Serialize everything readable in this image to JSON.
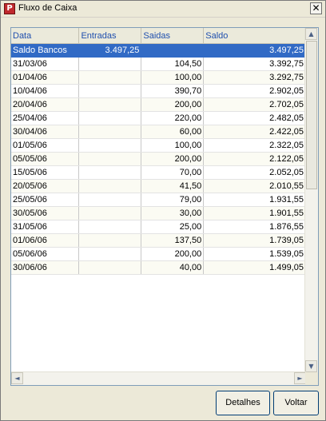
{
  "window": {
    "title": "Fluxo de Caixa",
    "icon_name": "app-logo-icon",
    "close_label": "✕"
  },
  "table": {
    "columns": [
      "Data",
      "Entradas",
      "Saidas",
      "Saldo"
    ],
    "rows": [
      {
        "data": "Saldo Bancos",
        "entradas": "3.497,25",
        "saidas": "",
        "saldo": "3.497,25"
      },
      {
        "data": "31/03/06",
        "entradas": "",
        "saidas": "104,50",
        "saldo": "3.392,75"
      },
      {
        "data": "01/04/06",
        "entradas": "",
        "saidas": "100,00",
        "saldo": "3.292,75"
      },
      {
        "data": "10/04/06",
        "entradas": "",
        "saidas": "390,70",
        "saldo": "2.902,05"
      },
      {
        "data": "20/04/06",
        "entradas": "",
        "saidas": "200,00",
        "saldo": "2.702,05"
      },
      {
        "data": "25/04/06",
        "entradas": "",
        "saidas": "220,00",
        "saldo": "2.482,05"
      },
      {
        "data": "30/04/06",
        "entradas": "",
        "saidas": "60,00",
        "saldo": "2.422,05"
      },
      {
        "data": "01/05/06",
        "entradas": "",
        "saidas": "100,00",
        "saldo": "2.322,05"
      },
      {
        "data": "05/05/06",
        "entradas": "",
        "saidas": "200,00",
        "saldo": "2.122,05"
      },
      {
        "data": "15/05/06",
        "entradas": "",
        "saidas": "70,00",
        "saldo": "2.052,05"
      },
      {
        "data": "20/05/06",
        "entradas": "",
        "saidas": "41,50",
        "saldo": "2.010,55"
      },
      {
        "data": "25/05/06",
        "entradas": "",
        "saidas": "79,00",
        "saldo": "1.931,55"
      },
      {
        "data": "30/05/06",
        "entradas": "",
        "saidas": "30,00",
        "saldo": "1.901,55"
      },
      {
        "data": "31/05/06",
        "entradas": "",
        "saidas": "25,00",
        "saldo": "1.876,55"
      },
      {
        "data": "01/06/06",
        "entradas": "",
        "saidas": "137,50",
        "saldo": "1.739,05"
      },
      {
        "data": "05/06/06",
        "entradas": "",
        "saidas": "200,00",
        "saldo": "1.539,05"
      },
      {
        "data": "30/06/06",
        "entradas": "",
        "saidas": "40,00",
        "saldo": "1.499,05"
      }
    ],
    "selected_row": 0
  },
  "scrollbar": {
    "up_icon": "▲",
    "down_icon": "▼",
    "left_icon": "◄",
    "right_icon": "►"
  },
  "buttons": {
    "detalhes": "Detalhes",
    "voltar": "Voltar"
  },
  "colors": {
    "selection": "#316ac5",
    "header_text": "#1f4fae",
    "window_bg": "#ece9d8"
  }
}
